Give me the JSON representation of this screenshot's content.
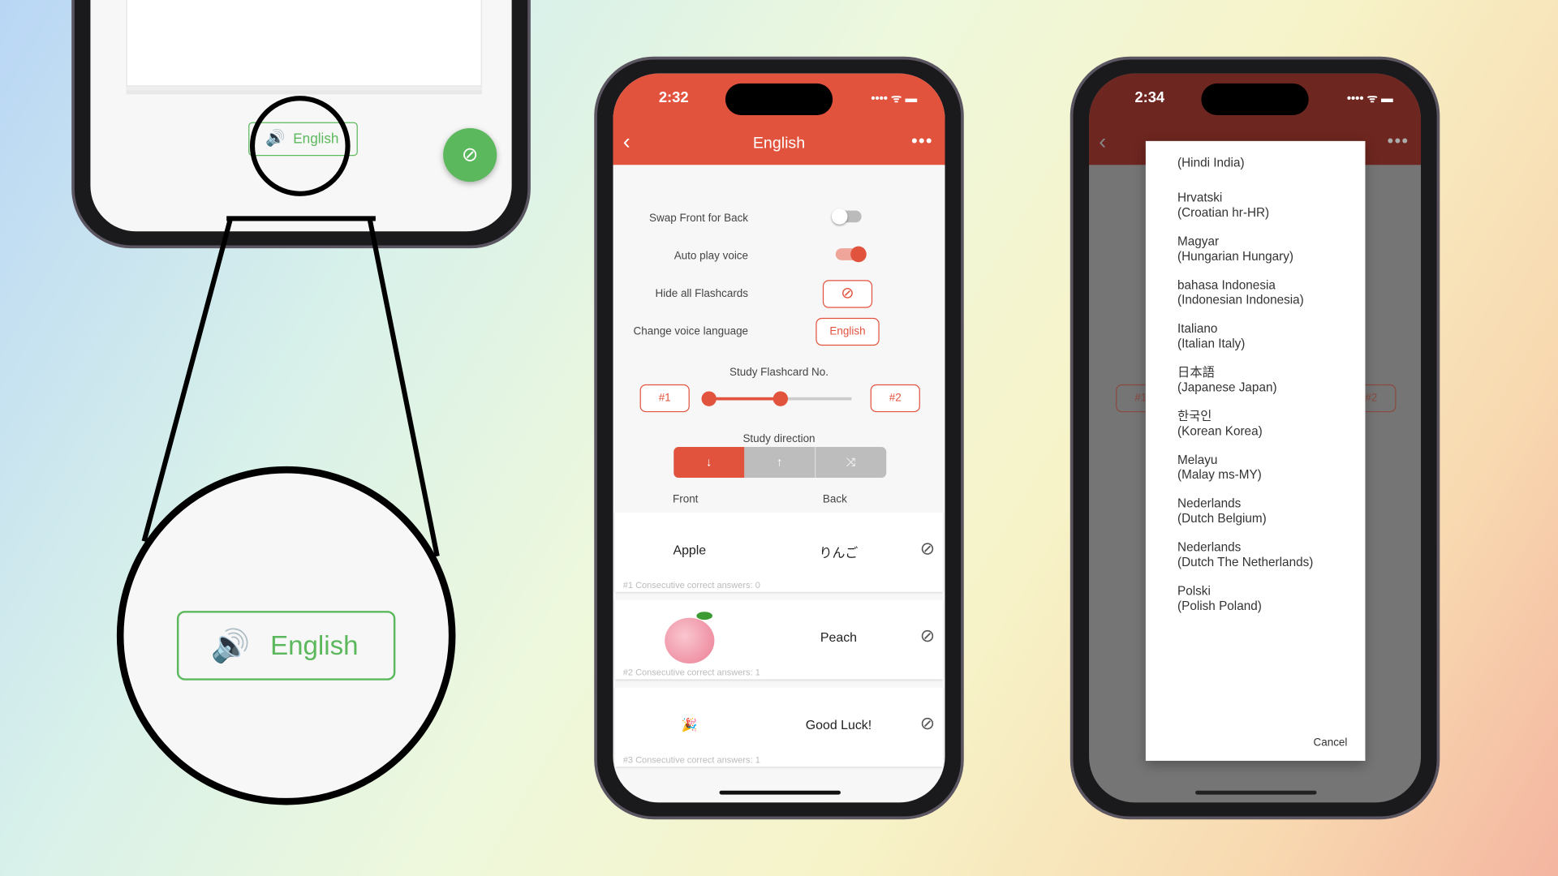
{
  "zoom_panel": {
    "lang_button": "English",
    "magnified_label": "English"
  },
  "phone2": {
    "time": "2:32",
    "title": "English",
    "settings": {
      "swap_label": "Swap Front for Back",
      "swap_on": false,
      "auto_play_label": "Auto play voice",
      "auto_play_on": true,
      "hide_label": "Hide all Flashcards",
      "voice_label": "Change voice language",
      "voice_value": "English"
    },
    "study_no": {
      "label": "Study Flashcard No.",
      "from": "#1",
      "to": "#2",
      "range": [
        1,
        2
      ]
    },
    "direction": {
      "label": "Study direction",
      "selected": "down",
      "front": "Front",
      "back": "Back"
    },
    "cards": [
      {
        "front": "Apple",
        "back": "りんご",
        "meta": "#1   Consecutive correct answers: 0"
      },
      {
        "front": "",
        "front_icon": "peach-emoji",
        "back": "Peach",
        "meta": "#2   Consecutive correct answers: 1"
      },
      {
        "front": "🎉",
        "back": "Good Luck!",
        "meta": "#3   Consecutive correct answers: 1"
      }
    ]
  },
  "phone3": {
    "time": "2:34",
    "languages": [
      {
        "name": "",
        "desc": "(Hindi India)"
      },
      {
        "name": "Hrvatski",
        "desc": "(Croatian hr-HR)"
      },
      {
        "name": "Magyar",
        "desc": "(Hungarian Hungary)"
      },
      {
        "name": "bahasa Indonesia",
        "desc": "(Indonesian Indonesia)"
      },
      {
        "name": "Italiano",
        "desc": "(Italian Italy)"
      },
      {
        "name": "日本語",
        "desc": "(Japanese Japan)"
      },
      {
        "name": "한국인",
        "desc": "(Korean Korea)"
      },
      {
        "name": "Melayu",
        "desc": "(Malay ms-MY)"
      },
      {
        "name": "Nederlands",
        "desc": "(Dutch Belgium)"
      },
      {
        "name": "Nederlands",
        "desc": "(Dutch The Netherlands)"
      },
      {
        "name": "Polski",
        "desc": "(Polish Poland)"
      }
    ],
    "cancel": "Cancel",
    "bg_from": "#1",
    "bg_to": "#2"
  },
  "colors": {
    "accent": "#e2533e",
    "green": "#5cb85c"
  }
}
